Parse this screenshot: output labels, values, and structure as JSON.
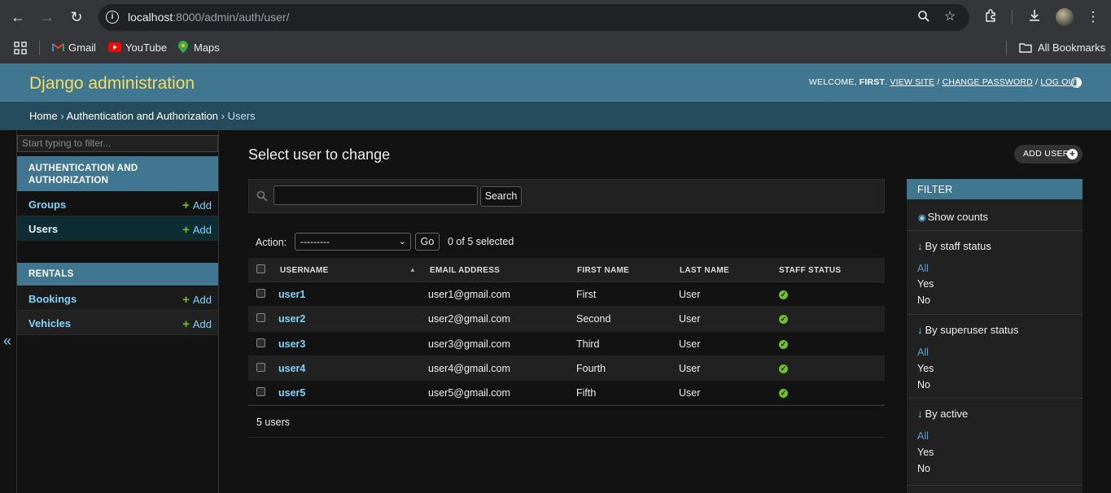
{
  "browser": {
    "url_host": "localhost",
    "url_rest": ":8000/admin/auth/user/",
    "bookmarks": [
      "Gmail",
      "YouTube",
      "Maps"
    ],
    "all_bookmarks": "All Bookmarks"
  },
  "header": {
    "branding": "Django administration",
    "welcome": "WELCOME,",
    "username": "FIRST",
    "view_site": "VIEW SITE",
    "change_password": "CHANGE PASSWORD",
    "log_out": "LOG OUT",
    "sep": "/"
  },
  "breadcrumbs": {
    "home": "Home",
    "app": "Authentication and Authorization",
    "current": "Users",
    "sep": "›"
  },
  "sidebar": {
    "filter_placeholder": "Start typing to filter...",
    "modules": [
      {
        "caption": "AUTHENTICATION AND AUTHORIZATION",
        "models": [
          {
            "name": "Groups",
            "add": "Add"
          },
          {
            "name": "Users",
            "add": "Add"
          }
        ]
      },
      {
        "caption": "RENTALS",
        "models": [
          {
            "name": "Bookings",
            "add": "Add"
          },
          {
            "name": "Vehicles",
            "add": "Add"
          }
        ]
      }
    ],
    "collapse": "«"
  },
  "content": {
    "title": "Select user to change",
    "add_user": "ADD USER",
    "search_button": "Search",
    "action_label": "Action:",
    "action_selected": "---------",
    "go": "Go",
    "selected_count": "0 of 5 selected",
    "columns": [
      "USERNAME",
      "EMAIL ADDRESS",
      "FIRST NAME",
      "LAST NAME",
      "STAFF STATUS"
    ],
    "rows": [
      {
        "username": "user1",
        "email": "user1@gmail.com",
        "first": "First",
        "last": "User",
        "staff": true
      },
      {
        "username": "user2",
        "email": "user2@gmail.com",
        "first": "Second",
        "last": "User",
        "staff": true
      },
      {
        "username": "user3",
        "email": "user3@gmail.com",
        "first": "Third",
        "last": "User",
        "staff": true
      },
      {
        "username": "user4",
        "email": "user4@gmail.com",
        "first": "Fourth",
        "last": "User",
        "staff": true
      },
      {
        "username": "user5",
        "email": "user5@gmail.com",
        "first": "Fifth",
        "last": "User",
        "staff": true
      }
    ],
    "paginator": "5 users"
  },
  "filter": {
    "title": "FILTER",
    "show_counts": "Show counts",
    "groups": [
      {
        "title": "By staff status",
        "options": [
          "All",
          "Yes",
          "No"
        ],
        "selected": "All"
      },
      {
        "title": "By superuser status",
        "options": [
          "All",
          "Yes",
          "No"
        ],
        "selected": "All"
      },
      {
        "title": "By active",
        "options": [
          "All",
          "Yes",
          "No"
        ],
        "selected": "All"
      }
    ]
  },
  "colors": {
    "header": "#417690",
    "breadcrumbs": "#264b5d",
    "branding": "#f5dd5d",
    "link": "#81d4fa",
    "add_green": "#70bf2b"
  }
}
